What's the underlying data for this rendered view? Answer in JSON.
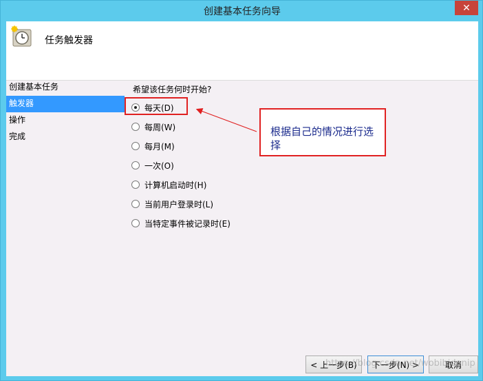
{
  "window": {
    "title": "创建基本任务向导",
    "close_label": "✕"
  },
  "header": {
    "title": "任务触发器",
    "icon": "clock-icon"
  },
  "nav": {
    "items": [
      {
        "label": "创建基本任务"
      },
      {
        "label": "触发器"
      },
      {
        "label": "操作"
      },
      {
        "label": "完成"
      }
    ]
  },
  "main": {
    "question": "希望该任务何时开始?",
    "options": [
      {
        "label": "每天(D)",
        "checked": true
      },
      {
        "label": "每周(W)",
        "checked": false
      },
      {
        "label": "每月(M)",
        "checked": false
      },
      {
        "label": "一次(O)",
        "checked": false
      },
      {
        "label": "计算机启动时(H)",
        "checked": false
      },
      {
        "label": "当前用户登录时(L)",
        "checked": false
      },
      {
        "label": "当特定事件被记录时(E)",
        "checked": false
      }
    ]
  },
  "annotation": {
    "text": "根据自己的情况进行选择",
    "color": "#e02020"
  },
  "footer": {
    "back_label": "< 上一步(B)",
    "next_label": "下一步(N) >",
    "cancel_label": "取消"
  },
  "watermark": "https://blog.csdn.net/wobibidanip"
}
